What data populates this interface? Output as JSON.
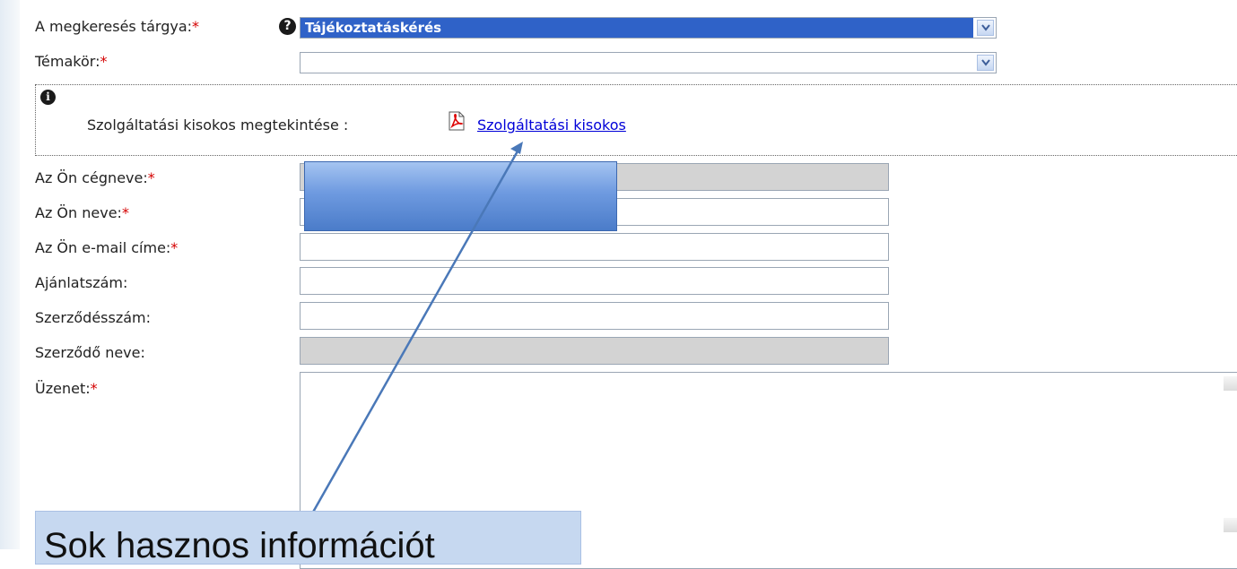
{
  "form": {
    "subject": {
      "label": "A megkeresés tárgya:",
      "required_mark": "*",
      "value": "Tájékoztatáskérés"
    },
    "topic": {
      "label": "Témakör:",
      "required_mark": "*",
      "value": ""
    },
    "info": {
      "text": "Szolgáltatási kisokos megtekintése :",
      "link_label": " Szolgáltatási kisokos"
    },
    "company_name": {
      "label": "Az Ön cégneve:",
      "required_mark": "*",
      "value": ""
    },
    "name": {
      "label": "Az Ön neve:",
      "required_mark": "*",
      "value": ""
    },
    "email": {
      "label": "Az Ön e-mail címe:",
      "required_mark": "*",
      "value": ""
    },
    "offer_number": {
      "label": "Ajánlatszám:",
      "value": ""
    },
    "contract_number": {
      "label": "Szerződésszám:",
      "value": ""
    },
    "contractor_name": {
      "label": "Szerződő neve:",
      "value": ""
    },
    "message": {
      "label": "Üzenet:",
      "required_mark": "*",
      "value": ""
    }
  },
  "callout": {
    "text": "Sok hasznos információt"
  },
  "icons": {
    "help": "question-circle-icon",
    "info": "info-circle-icon",
    "pdf": "pdf-file-icon",
    "dropdown": "chevron-down-icon"
  },
  "colors": {
    "required": "#d40000",
    "selected_bg": "#2f62c8",
    "link": "#0000d8",
    "readonly_bg": "#d3d3d3",
    "callout_bg": "#c6d8f0",
    "arrow": "#4a78b8"
  }
}
